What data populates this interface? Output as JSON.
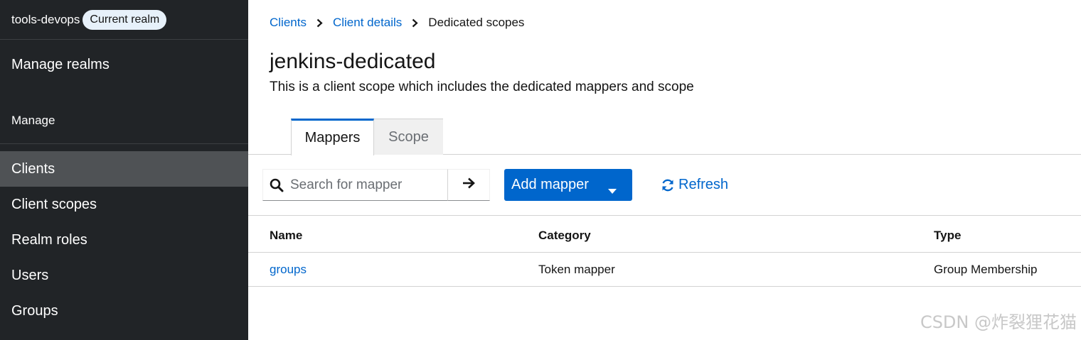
{
  "sidebar": {
    "realm_name": "tools-devops",
    "realm_badge": "Current realm",
    "manage_realms": "Manage realms",
    "section_label": "Manage",
    "items": [
      {
        "label": "Clients",
        "active": true
      },
      {
        "label": "Client scopes"
      },
      {
        "label": "Realm roles"
      },
      {
        "label": "Users"
      },
      {
        "label": "Groups"
      }
    ]
  },
  "breadcrumb": {
    "items": [
      "Clients",
      "Client details",
      "Dedicated scopes"
    ]
  },
  "page": {
    "title": "jenkins-dedicated",
    "description": "This is a client scope which includes the dedicated mappers and scope"
  },
  "tabs": [
    {
      "label": "Mappers",
      "active": true
    },
    {
      "label": "Scope"
    }
  ],
  "toolbar": {
    "search_placeholder": "Search for mapper",
    "search_icon": "search-icon",
    "go_icon": "arrow-right-icon",
    "add_mapper_label": "Add mapper",
    "refresh_label": "Refresh"
  },
  "table": {
    "columns": [
      "Name",
      "Category",
      "Type"
    ],
    "rows": [
      {
        "name": "groups",
        "category": "Token mapper",
        "type": "Group Membership"
      }
    ]
  },
  "watermark": "CSDN @炸裂狸花猫",
  "colors": {
    "sidebar_bg": "#212427",
    "sidebar_active": "#4f5255",
    "accent": "#0066cc",
    "badge_bg": "#e7f1fa"
  }
}
